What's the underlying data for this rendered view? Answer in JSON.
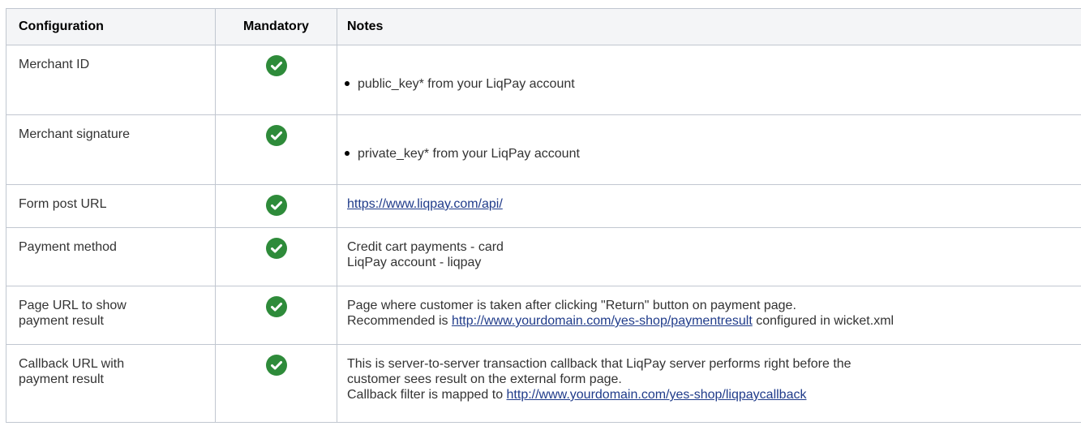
{
  "table": {
    "headers": [
      "Configuration",
      "Mandatory",
      "Notes"
    ],
    "rows": [
      {
        "name": "Merchant ID",
        "mandatory_icon": "check-circle-icon",
        "note_bullet": "public_key* from your LiqPay account"
      },
      {
        "name": "Merchant signature",
        "mandatory_icon": "check-circle-icon",
        "note_bullet": "private_key* from your LiqPay account"
      },
      {
        "name": "Form post URL",
        "mandatory_icon": "check-circle-icon",
        "note_link": "https://www.liqpay.com/api/"
      },
      {
        "name": "Payment method",
        "mandatory_icon": "check-circle-icon",
        "note_lines": [
          "Credit cart payments - card",
          "LiqPay account - liqpay"
        ]
      },
      {
        "name_lines": [
          "Page URL to show",
          "payment result"
        ],
        "mandatory_icon": "check-circle-icon",
        "note_line1": "Page where customer is taken after clicking \"Return\" button on payment page.",
        "note_line2_prefix": "Recommended is ",
        "note_line2_link": "http://www.yourdomain.com/yes-shop/paymentresult",
        "note_line2_suffix": " configured in wicket.xml"
      },
      {
        "name_lines": [
          "Callback URL with",
          "payment result"
        ],
        "mandatory_icon": "check-circle-icon",
        "note_line1": "This is server-to-server transaction callback that LiqPay server performs right before the",
        "note_line2": "customer sees result on the external form page.",
        "note_line3_prefix": "Callback filter is mapped to ",
        "note_line3_link": "http://www.yourdomain.com/yes-shop/liqpaycallback"
      }
    ]
  },
  "colors": {
    "check_green": "#2e8b3a",
    "link": "#1f3b8a",
    "header_bg": "#f4f5f7",
    "border": "#c1c7d0"
  }
}
